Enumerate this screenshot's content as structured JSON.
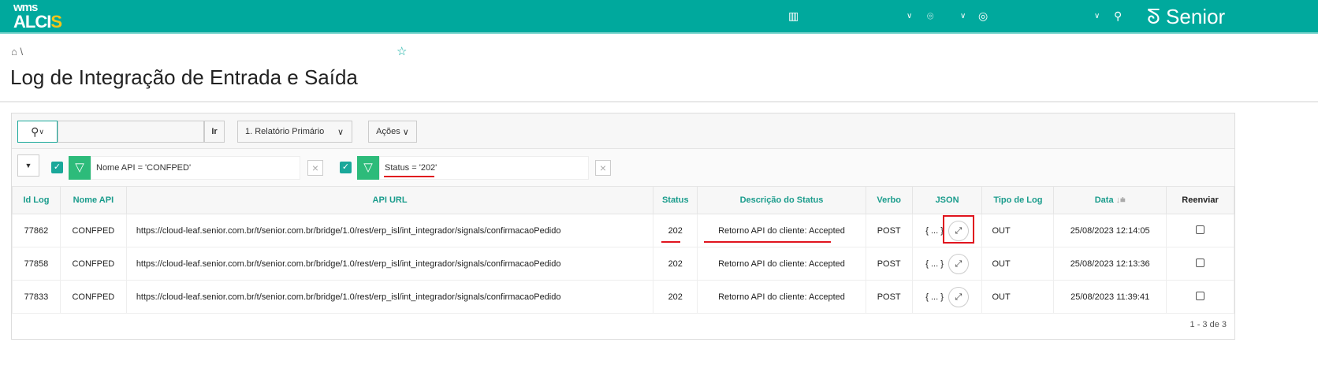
{
  "header": {
    "logo_top": "wms",
    "logo_main": "ALCI",
    "logo_accent": "S",
    "brand": "Senior"
  },
  "page": {
    "title": "Log de Integração de Entrada e Saída",
    "breadcrumb_sep": "\\"
  },
  "toolbar": {
    "search_value": "",
    "go_label": "Ir",
    "report_select": "1. Relatório Primário",
    "actions_label": "Ações"
  },
  "filters": [
    {
      "text": "Nome API = 'CONFPED'"
    },
    {
      "text": "Status = '202'"
    }
  ],
  "table": {
    "columns": [
      "Id Log",
      "Nome API",
      "API URL",
      "Status",
      "Descrição do Status",
      "Verbo",
      "JSON",
      "Tipo de Log",
      "Data",
      "Reenviar"
    ],
    "rows": [
      {
        "id": "77862",
        "api": "CONFPED",
        "url": "https://cloud-leaf.senior.com.br/t/senior.com.br/bridge/1.0/rest/erp_isl/int_integrador/signals/confirmacaoPedido",
        "status": "202",
        "desc": "Retorno API do cliente: Accepted",
        "verb": "POST",
        "json": "{ ... }",
        "type": "OUT",
        "date": "25/08/2023 12:14:05"
      },
      {
        "id": "77858",
        "api": "CONFPED",
        "url": "https://cloud-leaf.senior.com.br/t/senior.com.br/bridge/1.0/rest/erp_isl/int_integrador/signals/confirmacaoPedido",
        "status": "202",
        "desc": "Retorno API do cliente: Accepted",
        "verb": "POST",
        "json": "{ ... }",
        "type": "OUT",
        "date": "25/08/2023 12:13:36"
      },
      {
        "id": "77833",
        "api": "CONFPED",
        "url": "https://cloud-leaf.senior.com.br/t/senior.com.br/bridge/1.0/rest/erp_isl/int_integrador/signals/confirmacaoPedido",
        "status": "202",
        "desc": "Retorno API do cliente: Accepted",
        "verb": "POST",
        "json": "{ ... }",
        "type": "OUT",
        "date": "25/08/2023 11:39:41"
      }
    ],
    "pagination": "1 - 3 de 3"
  },
  "colors": {
    "brand": "#00a99d",
    "annotation": "#e0141e"
  }
}
